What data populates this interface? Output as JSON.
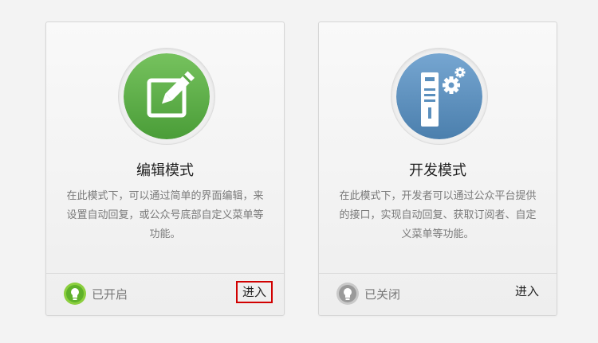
{
  "cards": [
    {
      "title": "编辑模式",
      "description": "在此模式下，可以通过简单的界面编辑，来设置自动回复，或公众号底部自定义菜单等功能。",
      "status": "已开启",
      "enter_label": "进入",
      "icon": "edit-icon",
      "status_icon": "lightbulb-on-icon",
      "accent_color": "#5fb14b"
    },
    {
      "title": "开发模式",
      "description": "在此模式下，开发者可以通过公众平台提供的接口，实现自动回复、获取订阅者、自定义菜单等功能。",
      "status": "已关闭",
      "enter_label": "进入",
      "icon": "server-gear-icon",
      "status_icon": "lightbulb-off-icon",
      "accent_color": "#5a8fbd"
    }
  ]
}
